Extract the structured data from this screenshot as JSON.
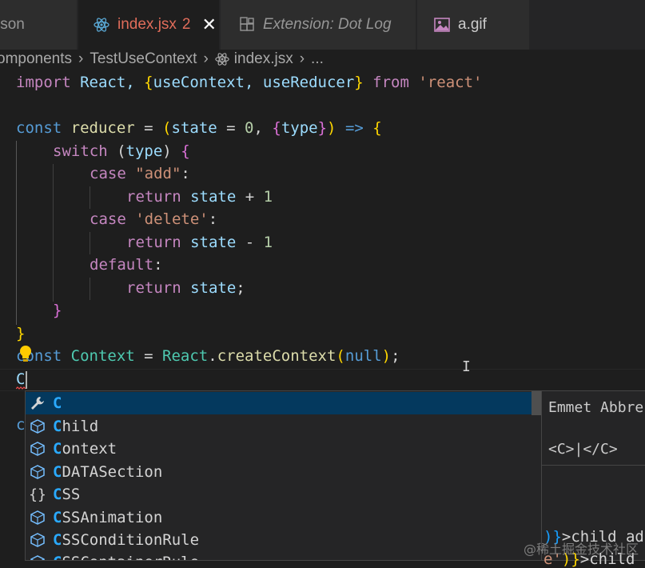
{
  "tabs": [
    {
      "label": "json",
      "active": false
    },
    {
      "label": "index.jsx",
      "modified_count": "2",
      "close": "✕",
      "active": true
    },
    {
      "label": "Extension: Dot Log",
      "active": false
    },
    {
      "label": "a.gif",
      "active": false
    }
  ],
  "breadcrumb": {
    "seg1": "omponents",
    "seg2": "TestUseContext",
    "seg3": "index.jsx",
    "seg4": "..."
  },
  "code": {
    "l1": {
      "kw": "import",
      "a": " React, ",
      "b": "{",
      "c": "useContext, useReducer",
      "d": "}",
      "e": " from ",
      "f": "'react'"
    },
    "l3": {
      "a": "const",
      "b": " reducer ",
      "c": "= ",
      "d": "(",
      "e": "state ",
      "f": "= ",
      "g": "0",
      "h": ", ",
      "i": "{",
      "j": "type",
      "k": "}",
      "l": ")",
      "m": " => ",
      "n": "{"
    },
    "l4": {
      "a": "switch",
      "b": " (",
      "c": "type",
      "d": ") ",
      "e": "{"
    },
    "l5": {
      "a": "case",
      "b": " \"add\"",
      "c": ":"
    },
    "l6": {
      "a": "return",
      "b": " state ",
      "c": "+ ",
      "d": "1"
    },
    "l7": {
      "a": "case",
      "b": " 'delete'",
      "c": ":"
    },
    "l8": {
      "a": "return",
      "b": " state ",
      "c": "- ",
      "d": "1"
    },
    "l9": {
      "a": "default",
      "b": ":"
    },
    "l10": {
      "a": "return",
      "b": " state",
      "c": ";"
    },
    "l11": {
      "a": "}"
    },
    "l12": {
      "a": "}"
    },
    "l13": {
      "a": "const",
      "b": " Context ",
      "c": "= ",
      "d": "React",
      "e": ".",
      "f": "createContext",
      "g": "(",
      "h": "null",
      "i": ")",
      "j": ";"
    },
    "l14": {
      "a": "C"
    },
    "l16": {
      "a": "c"
    }
  },
  "suggestions": [
    {
      "match": "C",
      "rest": "",
      "icon": "wrench-icon",
      "selected": true
    },
    {
      "match": "C",
      "rest": "hild",
      "icon": "variable-icon",
      "selected": false
    },
    {
      "match": "C",
      "rest": "ontext",
      "icon": "variable-icon",
      "selected": false
    },
    {
      "match": "C",
      "rest": "DATASection",
      "icon": "variable-icon",
      "selected": false
    },
    {
      "match": "C",
      "rest": "SS",
      "icon": "braces-icon",
      "selected": false
    },
    {
      "match": "C",
      "rest": "SSAnimation",
      "icon": "variable-icon",
      "selected": false
    },
    {
      "match": "C",
      "rest": "SSConditionRule",
      "icon": "variable-icon",
      "selected": false
    },
    {
      "match": "C",
      "rest": "SSContainerRule",
      "icon": "variable-icon",
      "selected": false
    }
  ],
  "details": {
    "title": "Emmet Abbre",
    "body": "<C>|</C>"
  },
  "below": {
    "r1a": ")}",
    "r1b": ">child add",
    "r2a": "e'",
    "r2b": ")}",
    "r2c": ">child"
  },
  "watermark": "@稀土掘金技术社区",
  "colors": {
    "accent": "#2aaaff",
    "selection": "#04395e",
    "modified": "#e06c5a"
  }
}
